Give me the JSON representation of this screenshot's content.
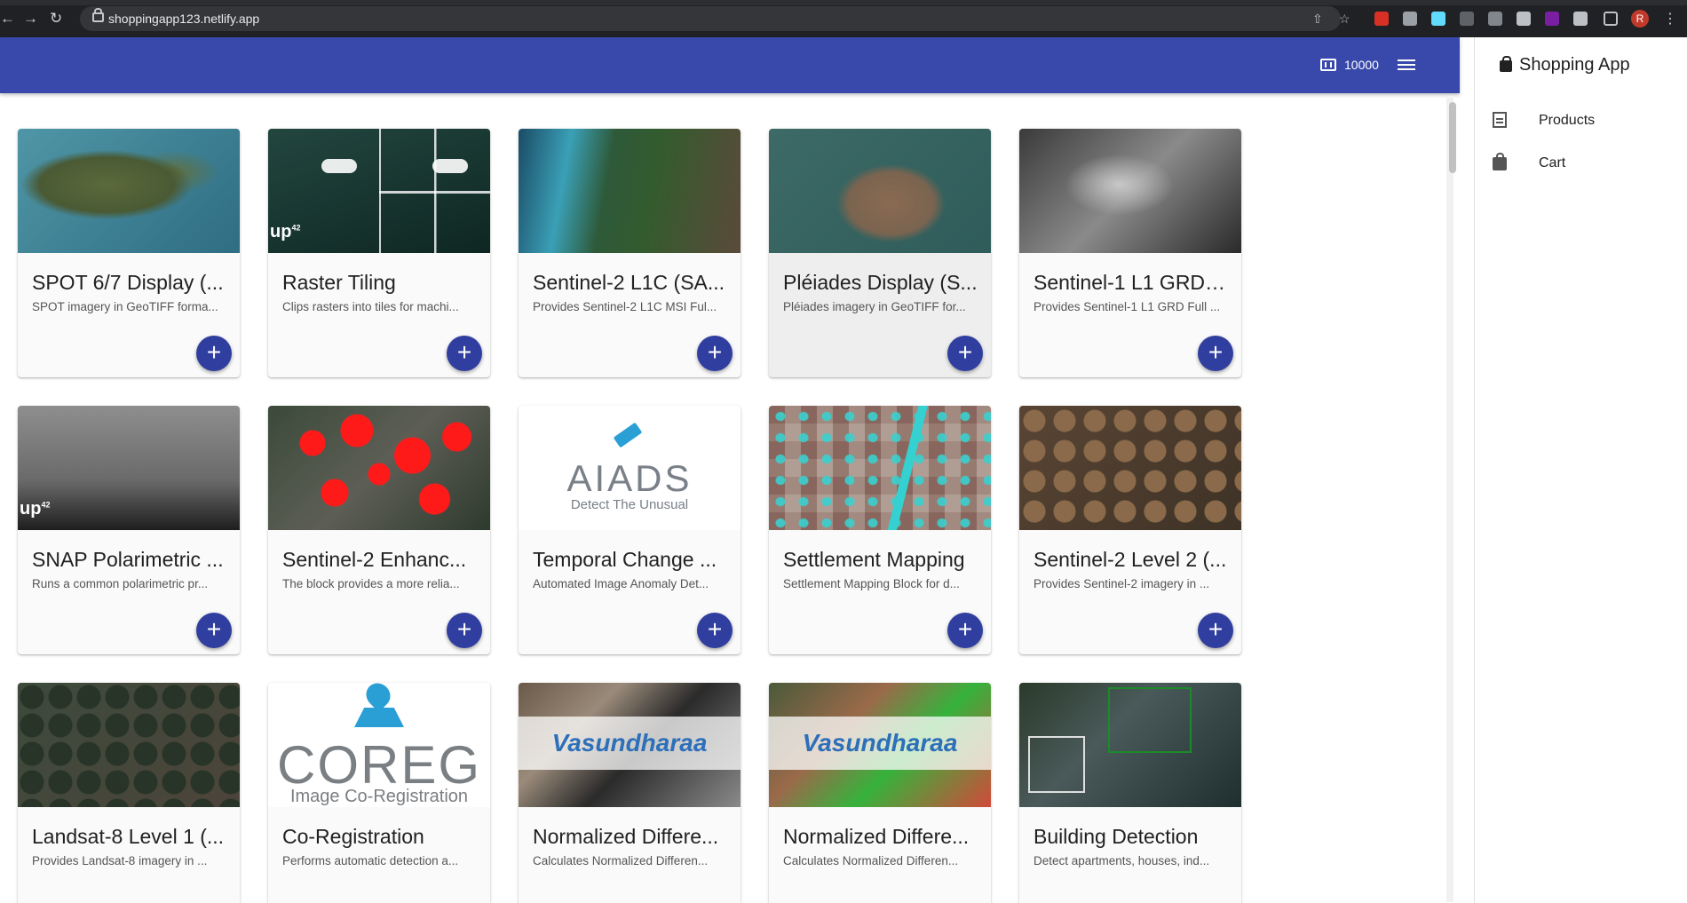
{
  "browser": {
    "url": "shoppingapp123.netlify.app",
    "profile_initial": "R"
  },
  "appbar": {
    "budget": "10000",
    "budget_icon": "counter-icon",
    "menu_icon": "hamburger-menu-icon"
  },
  "drawer": {
    "title": "Shopping App",
    "items": [
      {
        "label": "Products",
        "icon": "list-icon"
      },
      {
        "label": "Cart",
        "icon": "bag-icon"
      }
    ]
  },
  "products": [
    {
      "title": "SPOT 6/7 Display (...",
      "description": "SPOT imagery in GeoTIFF forma...",
      "add_label": "+"
    },
    {
      "title": "Raster Tiling",
      "description": "Clips rasters into tiles for machi...",
      "add_label": "+"
    },
    {
      "title": "Sentinel-2 L1C (SA...",
      "description": "Provides Sentinel-2 L1C MSI Ful...",
      "add_label": "+"
    },
    {
      "title": "Pléiades Display (S...",
      "description": "Pléiades imagery in GeoTIFF for...",
      "add_label": "+"
    },
    {
      "title": "Sentinel-1 L1 GRD (...",
      "description": "Provides Sentinel-1 L1 GRD Full ...",
      "add_label": "+"
    },
    {
      "title": "SNAP Polarimetric ...",
      "description": "Runs a common polarimetric pr...",
      "add_label": "+"
    },
    {
      "title": "Sentinel-2 Enhanc...",
      "description": "The block provides a more relia...",
      "add_label": "+"
    },
    {
      "title": "Temporal Change ...",
      "description": "Automated Image Anomaly Det...",
      "add_label": "+"
    },
    {
      "title": "Settlement Mapping",
      "description": "Settlement Mapping Block for d...",
      "add_label": "+"
    },
    {
      "title": "Sentinel-2 Level 2 (...",
      "description": "Provides Sentinel-2 imagery in ...",
      "add_label": "+"
    },
    {
      "title": "Landsat-8 Level 1 (...",
      "description": "Provides Landsat-8 imagery in ...",
      "add_label": "+"
    },
    {
      "title": "Co-Registration",
      "description": "Performs automatic detection a...",
      "add_label": "+"
    },
    {
      "title": "Normalized Differe...",
      "description": "Calculates Normalized Differen...",
      "add_label": "+"
    },
    {
      "title": "Normalized Differe...",
      "description": "Calculates Normalized Differen...",
      "add_label": "+"
    },
    {
      "title": "Building Detection",
      "description": "Detect apartments, houses, ind...",
      "add_label": "+"
    }
  ],
  "logos": {
    "up42": "up",
    "up42_sup": "42",
    "aiads_word": "AIADS",
    "aiads_tag": "Detect The Unusual",
    "coreg_word": "COREG",
    "coreg_tag": "Image Co-Registration",
    "vasundharaa": "Vasundharaa"
  }
}
